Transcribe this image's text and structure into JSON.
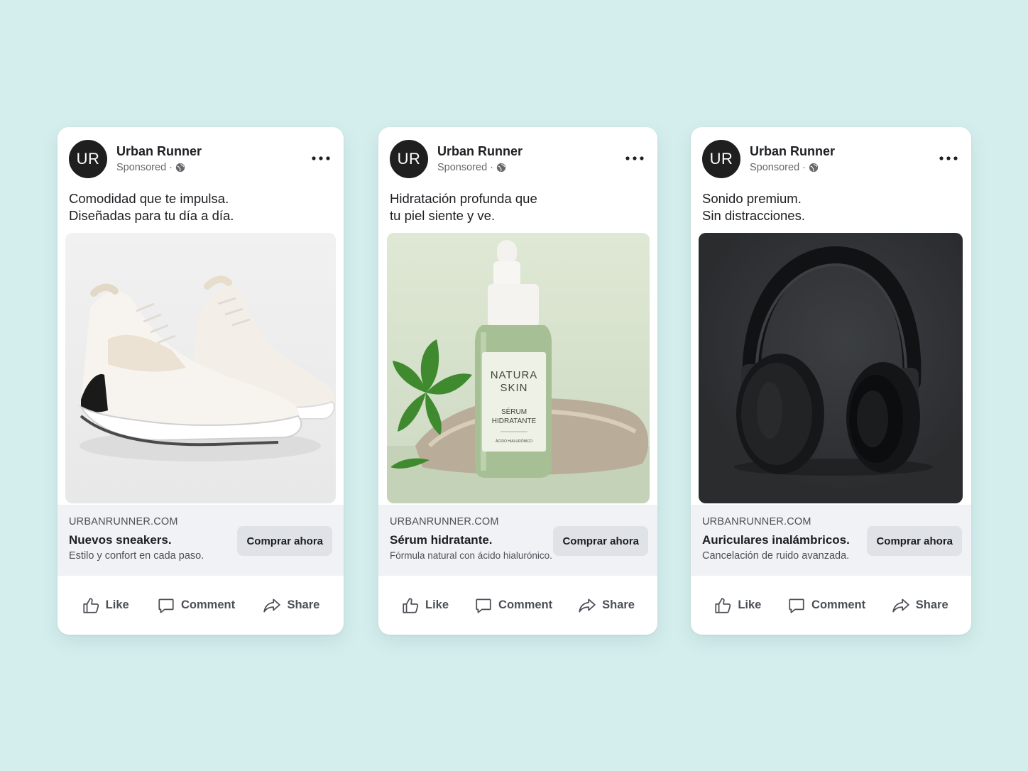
{
  "colors": {
    "background": "#d4eeed",
    "card": "#ffffff",
    "avatar": "#1f1f1f",
    "link_panel": "#f0f2f5",
    "cta": "#dfe2e6"
  },
  "icons": [
    "globe-icon",
    "more-icon",
    "like-icon",
    "comment-icon",
    "share-icon"
  ],
  "posts": [
    {
      "avatar_initials": "UR",
      "page_name": "Urban Runner",
      "sponsored": "Sponsored ·",
      "caption": [
        "Comodidad que te impulsa.",
        "Diseñadas para tu día a día."
      ],
      "domain": "URBANRUNNER.COM",
      "headline": "Nuevos sneakers.",
      "description": "Estilo y confort en cada paso.",
      "cta": "Comprar ahora",
      "actions": {
        "like": "Like",
        "comment": "Comment",
        "share": "Share"
      }
    },
    {
      "avatar_initials": "UR",
      "page_name": "Urban Runner",
      "sponsored": "Sponsored ·",
      "caption": [
        "Hidratación profunda que",
        "tu piel siente y ve."
      ],
      "domain": "URBANRUNNER.COM",
      "headline": "Sérum hidratante.",
      "description": "Fórmula natural con ácido hialurónico.",
      "cta": "Comprar ahora",
      "product_label": {
        "brand_line1": "NATURA",
        "brand_line2": "SKIN",
        "product_line1": "SÉRUM",
        "product_line2": "HIDRATANTE",
        "small": "ÁCIDO HIALURÓNICO"
      },
      "actions": {
        "like": "Like",
        "comment": "Comment",
        "share": "Share"
      }
    },
    {
      "avatar_initials": "UR",
      "page_name": "Urban Runner",
      "sponsored": "Sponsored ·",
      "caption": [
        "Sonido premium.",
        "Sin distracciones."
      ],
      "domain": "URBANRUNNER.COM",
      "headline": "Auriculares inalámbricos.",
      "description": "Cancelación de ruido avanzada.",
      "cta": "Comprar ahora",
      "actions": {
        "like": "Like",
        "comment": "Comment",
        "share": "Share"
      }
    }
  ]
}
